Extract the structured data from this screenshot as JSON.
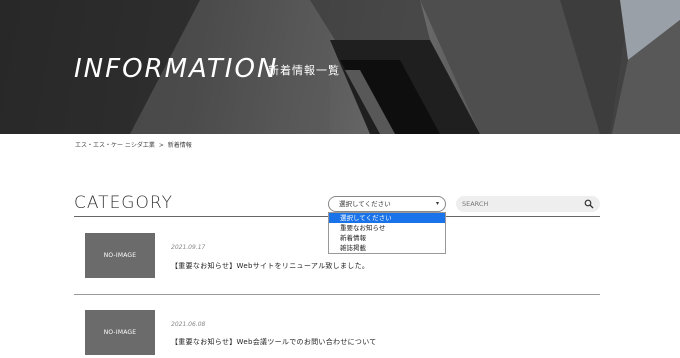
{
  "hero": {
    "title": "INFORMATION",
    "subtitle": "新着情報一覧"
  },
  "breadcrumb": {
    "home": "エス・エス・ケー ニシダ工業",
    "separator": ">",
    "current": "新着情報"
  },
  "category": {
    "heading": "CATEGORY",
    "select_value": "選択してください",
    "options": [
      "選択してください",
      "重要なお知らせ",
      "新着情報",
      "雑誌掲載"
    ]
  },
  "search": {
    "placeholder": "SEARCH"
  },
  "posts": [
    {
      "thumb": "NO-IMAGE",
      "date": "2021.09.17",
      "title": "【重要なお知らせ】Webサイトをリニューアル致しました。"
    },
    {
      "thumb": "NO-IMAGE",
      "date": "2021.06.08",
      "title": "【重要なお知らせ】Web会議ツールでのお問い合わせについて"
    }
  ],
  "icons": {
    "search": "search-icon",
    "dropdown": "chevron-down-icon"
  }
}
